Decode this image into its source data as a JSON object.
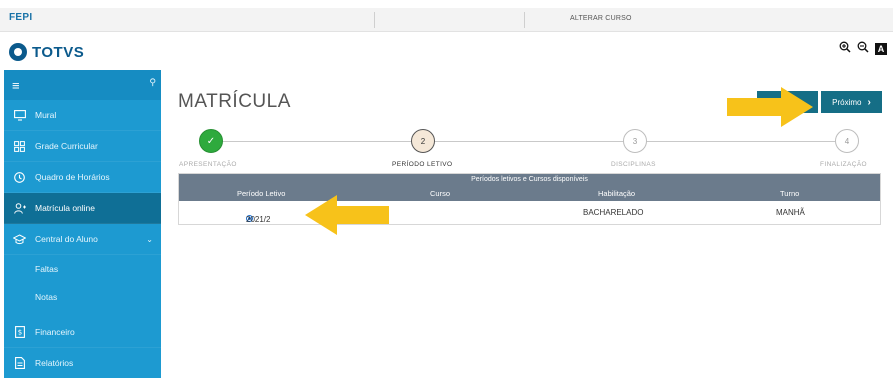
{
  "topbar": {
    "brand": "FEPI",
    "course_link": "ALTERAR CURSO"
  },
  "header": {
    "logo_text": "TOTVS",
    "zoom_in_icon": "zoom-in-icon",
    "zoom_out_icon": "zoom-out-icon",
    "accessibility_icon": "accessibility-icon"
  },
  "sidebar": {
    "items": [
      {
        "label": "Mural",
        "icon": "monitor-icon"
      },
      {
        "label": "Grade Curricular",
        "icon": "grid-icon"
      },
      {
        "label": "Quadro de Horários",
        "icon": "clock-icon"
      },
      {
        "label": "Matrícula online",
        "icon": "user-add-icon",
        "active": true
      },
      {
        "label": "Central do Aluno",
        "icon": "graduation-cap-icon"
      }
    ],
    "subitems": [
      {
        "label": "Faltas"
      },
      {
        "label": "Notas"
      }
    ],
    "bottom_items": [
      {
        "label": "Financeiro",
        "icon": "invoice-icon"
      },
      {
        "label": "Relatórios",
        "icon": "report-icon"
      }
    ]
  },
  "page": {
    "title": "MATRÍCULA",
    "next_label": "Próximo"
  },
  "steps": [
    {
      "label": "APRESENTAÇÃO",
      "state": "done"
    },
    {
      "label": "PERÍODO LETIVO",
      "number": "2",
      "state": "current"
    },
    {
      "label": "DISCIPLINAS",
      "number": "3",
      "state": "todo"
    },
    {
      "label": "FINALIZAÇÃO",
      "number": "4",
      "state": "todo"
    }
  ],
  "table": {
    "caption": "Períodos letivos e Cursos disponíveis",
    "columns": [
      "Período Letivo",
      "Curso",
      "Habilitação",
      "Turno"
    ],
    "rows": [
      {
        "periodo": "2021/2",
        "curso": "",
        "habilitacao": "BACHARELADO",
        "turno": "MANHÃ",
        "selected": true
      }
    ]
  },
  "colors": {
    "sidebar": "#1d9ad1",
    "sidebar_active": "#0f6f96",
    "button": "#156e86",
    "table_header": "#6b7b8c",
    "step_done": "#2eaa3d",
    "annotation_arrow": "#f7c21a"
  }
}
